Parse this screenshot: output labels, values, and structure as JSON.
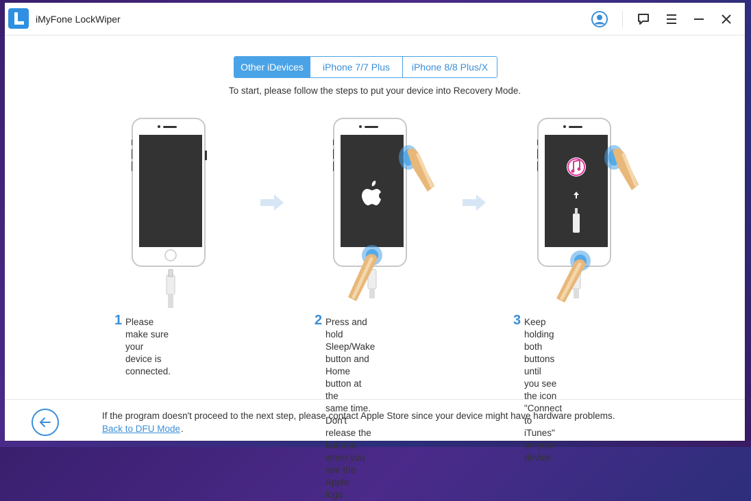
{
  "window": {
    "title": "iMyFone LockWiper",
    "icons": [
      "logo-icon",
      "account-icon",
      "feedback-icon",
      "menu-icon",
      "minimize-icon",
      "close-icon"
    ]
  },
  "tabs": [
    {
      "label": "Other iDevices",
      "active": true
    },
    {
      "label": "iPhone 7/7 Plus",
      "active": false
    },
    {
      "label": "iPhone 8/8 Plus/X",
      "active": false
    }
  ],
  "instruction": "To start, please follow the steps to put your device into Recovery Mode.",
  "steps": [
    {
      "num": "1",
      "lines": [
        "Please make sure your device is",
        "connected."
      ]
    },
    {
      "num": "2",
      "lines": [
        "Press and hold Sleep/Wake",
        "button and Home button at the",
        "same time. Don't release the",
        "buttons when you see the Apple",
        "logo."
      ]
    },
    {
      "num": "3",
      "lines": [
        "Keep holding both buttons until",
        "you see the icon \"Connect to",
        "iTunes\" on your device."
      ]
    }
  ],
  "footer": {
    "message": "If the program doesn't proceed to the next step, please contact Apple Store since your device might have hardware problems.",
    "link": "Back to DFU Mode",
    "link_suffix": "."
  },
  "colors": {
    "accent": "#4aa3e6",
    "link": "#3a8fd8",
    "phone_screen": "#333333",
    "finger": "#e8b87a"
  }
}
